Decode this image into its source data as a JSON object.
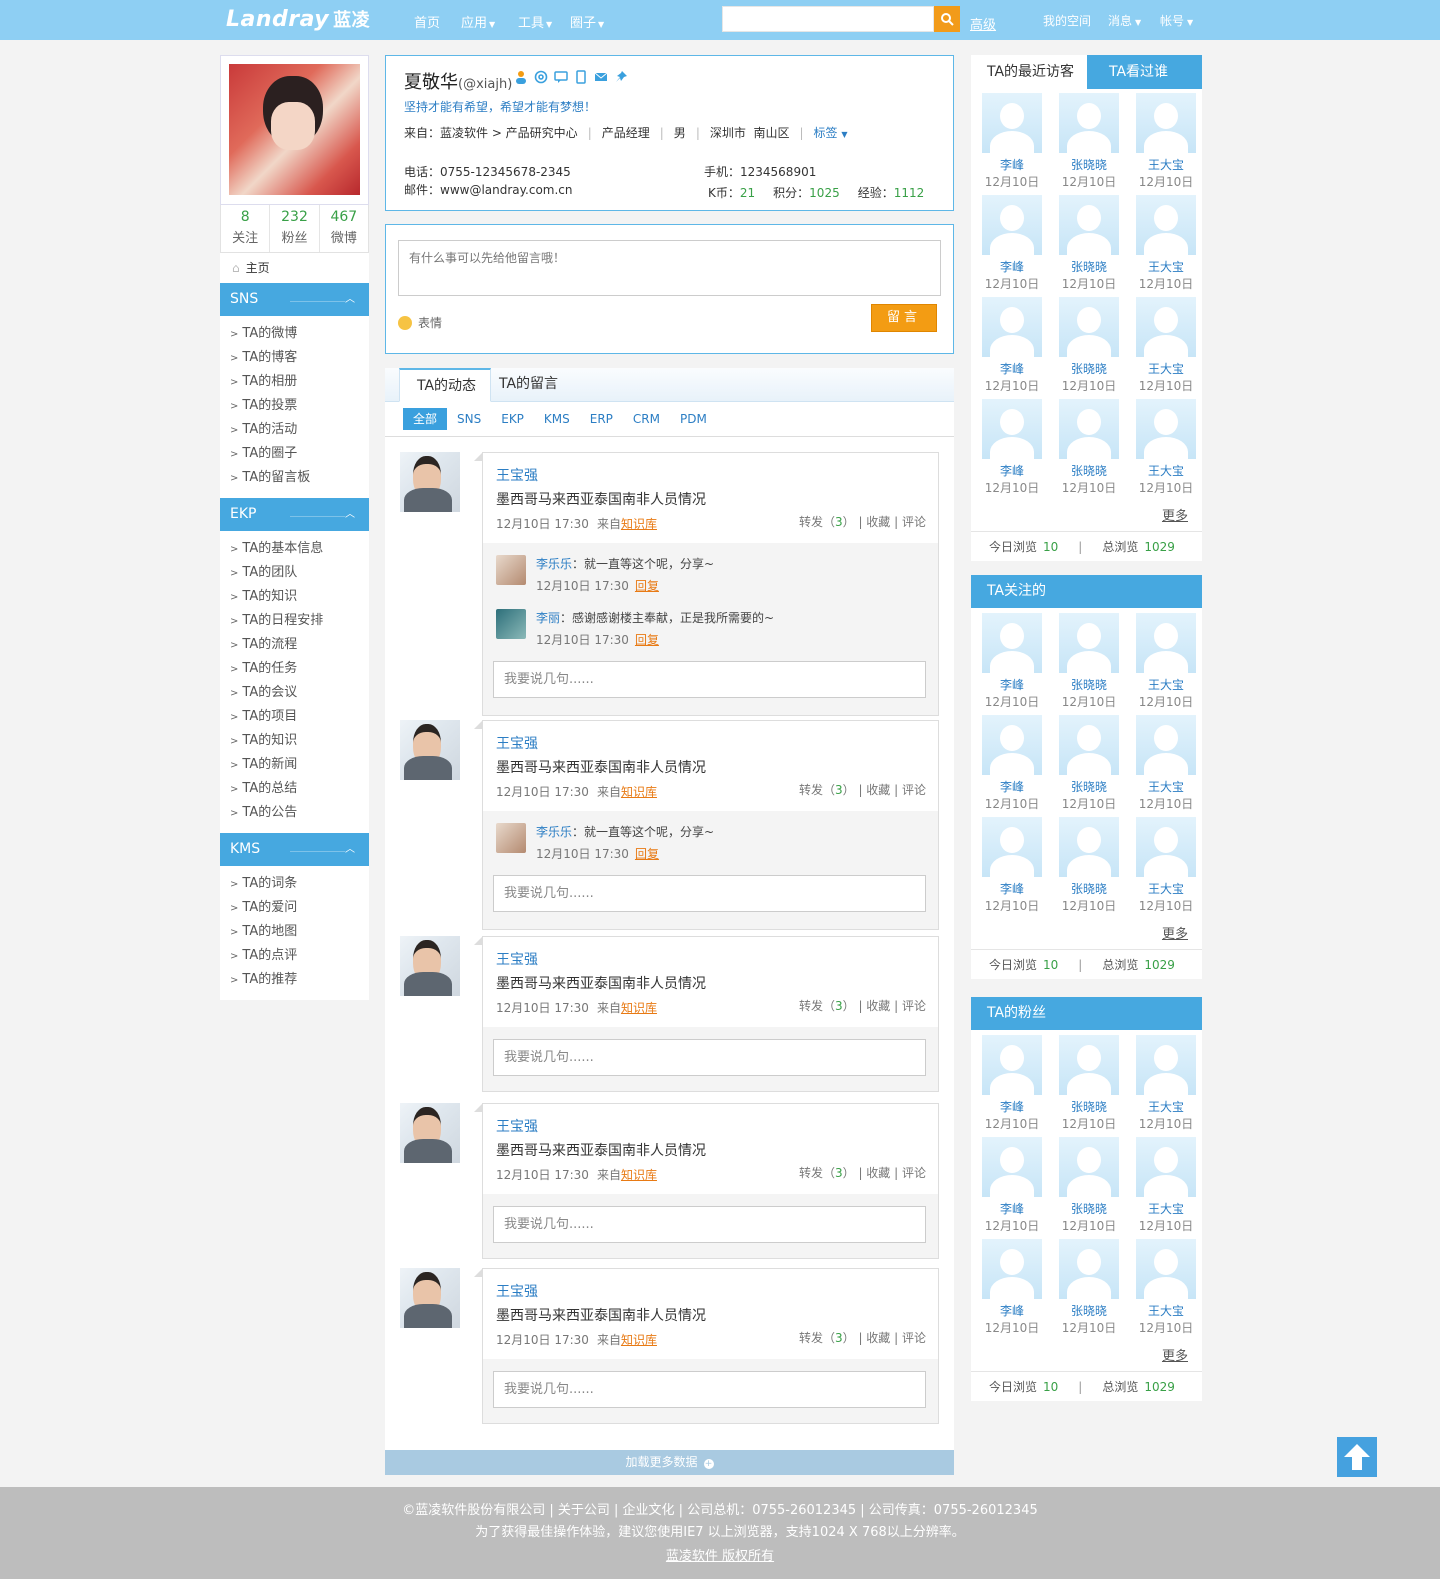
{
  "topbar": {
    "logo_en": "Landray",
    "logo_cn": "蓝凌",
    "nav": [
      "首页",
      "应用",
      "工具",
      "圈子"
    ],
    "search_placeholder": "",
    "advanced": "高级",
    "right_nav": [
      "我的空间",
      "消息",
      "帐号"
    ],
    "colors": {
      "bar": "#8ecff3",
      "search_button": "#f29b1a"
    }
  },
  "left": {
    "stats": [
      {
        "num": "8",
        "label": "关注"
      },
      {
        "num": "232",
        "label": "粉丝"
      },
      {
        "num": "467",
        "label": "微博"
      }
    ],
    "home": "主页",
    "sections": [
      {
        "title": "SNS",
        "items": [
          "TA的微博",
          "TA的博客",
          "TA的相册",
          "TA的投票",
          "TA的活动",
          "TA的圈子",
          "TA的留言板"
        ]
      },
      {
        "title": "EKP",
        "items": [
          "TA的基本信息",
          "TA的团队",
          "TA的知识",
          "TA的日程安排",
          "TA的流程",
          "TA的任务",
          "TA的会议",
          "TA的项目",
          "TA的知识",
          "TA的新闻",
          "TA的总结",
          "TA的公告"
        ]
      },
      {
        "title": "KMS",
        "items": [
          "TA的词条",
          "TA的爱问",
          "TA的地图",
          "TA的点评",
          "TA的推荐"
        ]
      }
    ]
  },
  "profile": {
    "name": "夏敬华",
    "handle": "(@xiajh)",
    "motto": "坚持才能有希望，希望才能有梦想！",
    "from": "来自：蓝凌软件 > 产品研究中心",
    "position": "产品经理",
    "gender": "男",
    "location": "深圳市  南山区",
    "tag": "标签",
    "phone": "电话：0755-12345678-2345",
    "email": "邮件：www@landray.com.cn",
    "mobile": "手机：1234568901",
    "kcoin_label": "K币：",
    "kcoin": "21",
    "points_label": "积分：",
    "points": "1025",
    "exp_label": "经验：",
    "exp": "1112"
  },
  "message": {
    "placeholder": "有什么事可以先给他留言哦！",
    "emotion": "表情",
    "submit": "留言"
  },
  "feed": {
    "tabs": [
      "TA的动态",
      "TA的留言"
    ],
    "filters": [
      "全部",
      "SNS",
      "EKP",
      "KMS",
      "ERP",
      "CRM",
      "PDM"
    ],
    "reply_placeholder": "我要说几句......",
    "load_more": "加载更多数据",
    "posts": [
      {
        "author": "王宝强",
        "title": "墨西哥马来西亚泰国南非人员情况",
        "date": "12月10日  17:30",
        "from_label": "来自",
        "source": "知识库",
        "share_label": "转发（",
        "shares": "3",
        "share_end": "）",
        "collect": "收藏",
        "comment": "评论",
        "replies": [
          {
            "name": "李乐乐",
            "text": "：就一直等这个呢，分享~",
            "date": "12月10日  17:30",
            "reply": "回复"
          },
          {
            "name": "李丽",
            "text": "：感谢感谢楼主奉献，正是我所需要的~",
            "date": "12月10日  17:30",
            "reply": "回复"
          }
        ]
      },
      {
        "author": "王宝强",
        "title": "墨西哥马来西亚泰国南非人员情况",
        "date": "12月10日  17:30",
        "from_label": "来自",
        "source": "知识库",
        "share_label": "转发（",
        "shares": "3",
        "share_end": "）",
        "collect": "收藏",
        "comment": "评论",
        "replies": [
          {
            "name": "李乐乐",
            "text": "：就一直等这个呢，分享~",
            "date": "12月10日  17:30",
            "reply": "回复"
          }
        ]
      },
      {
        "author": "王宝强",
        "title": "墨西哥马来西亚泰国南非人员情况",
        "date": "12月10日  17:30",
        "from_label": "来自",
        "source": "知识库",
        "share_label": "转发（",
        "shares": "3",
        "share_end": "）",
        "collect": "收藏",
        "comment": "评论",
        "replies": []
      },
      {
        "author": "王宝强",
        "title": "墨西哥马来西亚泰国南非人员情况",
        "date": "12月10日  17:30",
        "from_label": "来自",
        "source": "知识库",
        "share_label": "转发（",
        "shares": "3",
        "share_end": "）",
        "collect": "收藏",
        "comment": "评论",
        "replies": []
      },
      {
        "author": "王宝强",
        "title": "墨西哥马来西亚泰国南非人员情况",
        "date": "12月10日  17:30",
        "from_label": "来自",
        "source": "知识库",
        "share_label": "转发（",
        "shares": "3",
        "share_end": "）",
        "collect": "收藏",
        "comment": "评论",
        "replies": []
      }
    ]
  },
  "right": {
    "visitor_tabs": [
      "TA的最近访客",
      "TA看过谁"
    ],
    "following_title": "TA关注的",
    "fans_title": "TA的粉丝",
    "people": [
      {
        "name": "李峰",
        "date": "12月10日"
      },
      {
        "name": "张晓晓",
        "date": "12月10日"
      },
      {
        "name": "王大宝",
        "date": "12月10日"
      }
    ],
    "more": "更多",
    "today_label": "今日浏览",
    "today": "10",
    "total_label": "总浏览",
    "total": "1029"
  },
  "footer": {
    "line1": "©蓝凌软件股份有限公司 | 关于公司 | 企业文化  |  公司总机：0755-26012345 | 公司传真：0755-26012345",
    "line2": "为了获得最佳操作体验，建议您使用IE7 以上浏览器，支持1024 X 768以上分辨率。",
    "line3": "蓝凌软件 版权所有"
  }
}
